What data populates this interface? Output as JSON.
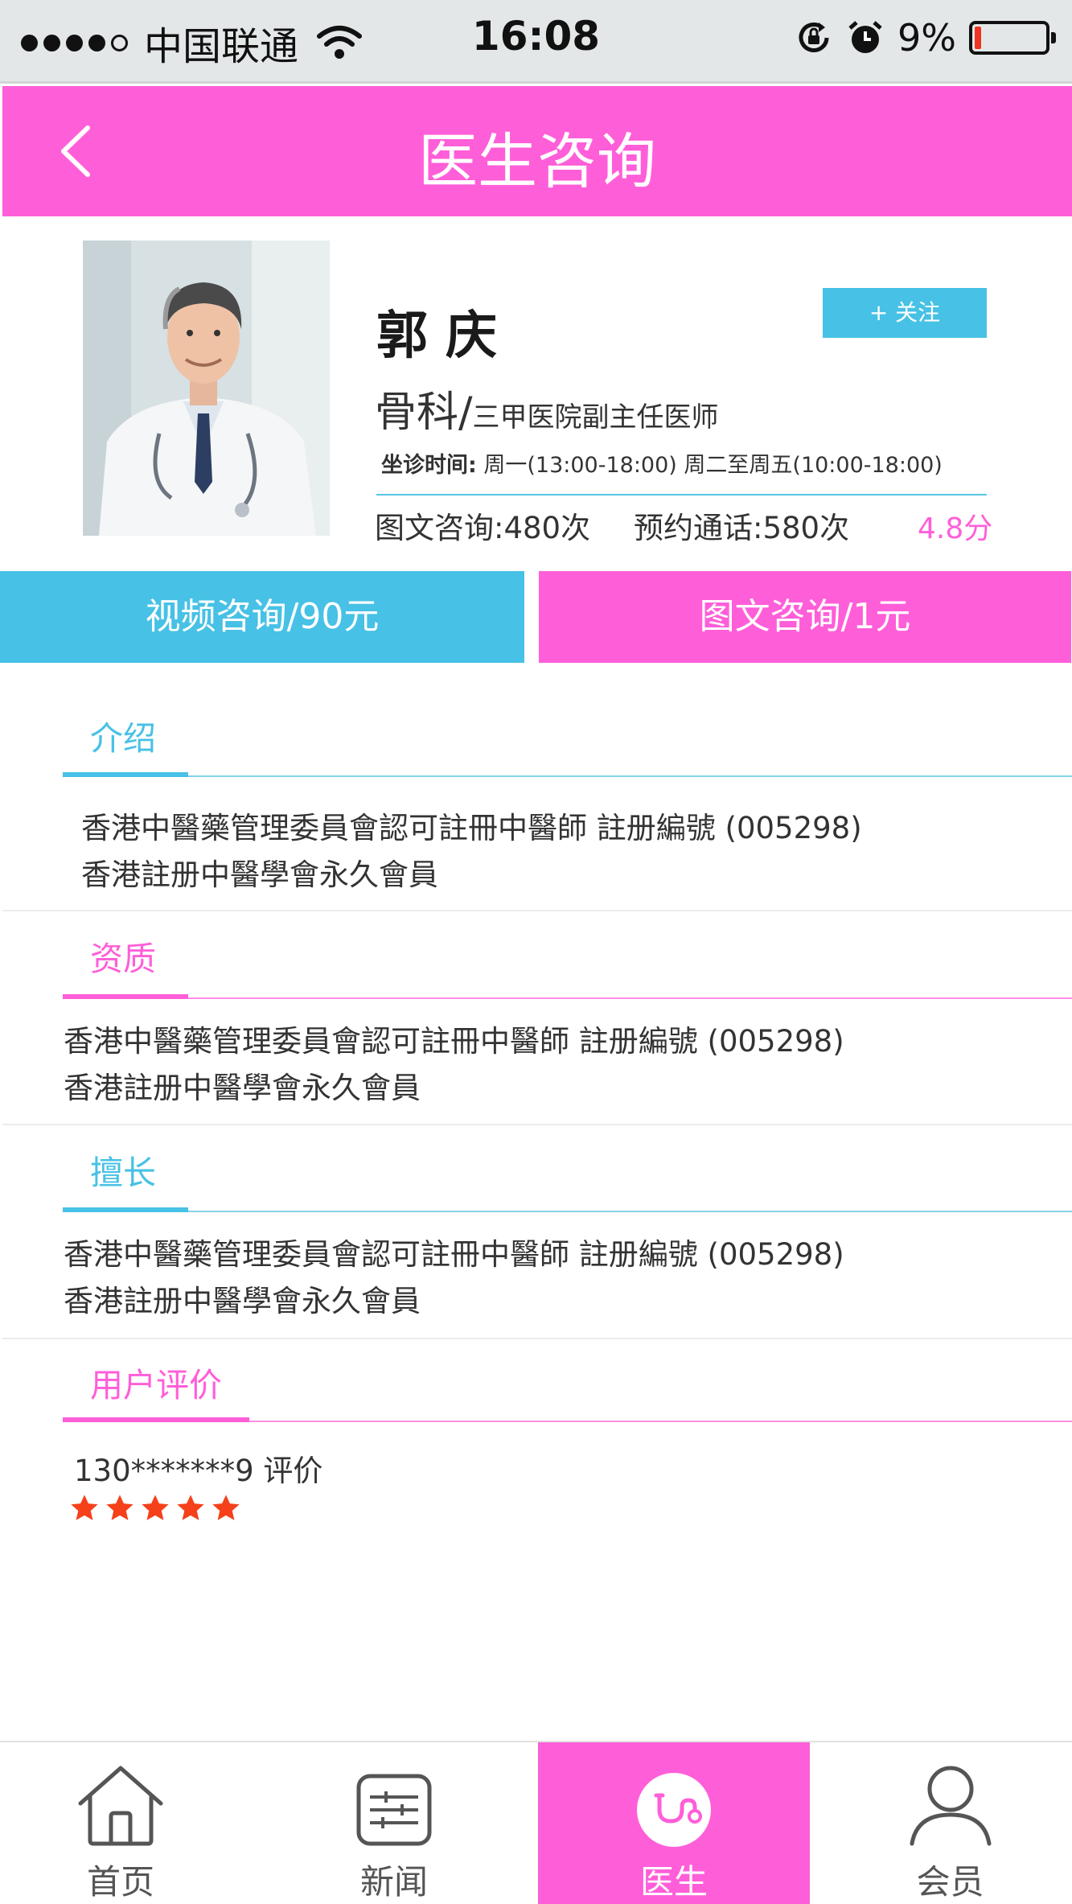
{
  "status_bar": {
    "carrier": "中国联通",
    "time": "16:08",
    "battery": "9%",
    "battery_level": 0.09,
    "icons": [
      "signal-dots-icon",
      "wifi-icon",
      "rotation-lock-icon",
      "alarm-icon",
      "battery-icon"
    ]
  },
  "nav": {
    "title": "医生咨询",
    "back_icon": "chevron-left-icon"
  },
  "doctor": {
    "name": "郭庆",
    "follow_label": "+ 关注",
    "department": "骨科",
    "separator": "/",
    "title": "三甲医院副主任医师",
    "hours_label": "坐诊时间:",
    "hours_value": " 周一(13:00-18:00) 周二至周五(10:00-18:00)",
    "stat_text": "图文咨询:480次",
    "stat_call": "预约通话:580次",
    "rating": "4.8分"
  },
  "actions": {
    "video": "视频咨询/90元",
    "text": "图文咨询/1元"
  },
  "sections": {
    "intro": {
      "title": "介绍",
      "line1": "香港中醫藥管理委員會認可註冊中醫師 註册編號 (005298)",
      "line2": "香港註册中醫學會永久會員"
    },
    "qualification": {
      "title": "资质",
      "line1": "香港中醫藥管理委員會認可註冊中醫師 註册編號 (005298)",
      "line2": "香港註册中醫學會永久會員"
    },
    "specialty": {
      "title": "擅长",
      "line1": "香港中醫藥管理委員會認可註冊中醫師 註册編號 (005298)",
      "line2": "香港註册中醫學會永久會員"
    },
    "reviews": {
      "title": "用户评价",
      "user": "130*******9  评价",
      "stars": 5
    }
  },
  "colors": {
    "pink": "#ff5ed9",
    "blue": "#47c1e5",
    "star": "#f5401a"
  },
  "tabs": [
    {
      "label": "首页",
      "icon": "home-icon"
    },
    {
      "label": "新闻",
      "icon": "news-icon"
    },
    {
      "label": "医生",
      "icon": "stethoscope-icon"
    },
    {
      "label": "会员",
      "icon": "user-icon"
    }
  ]
}
